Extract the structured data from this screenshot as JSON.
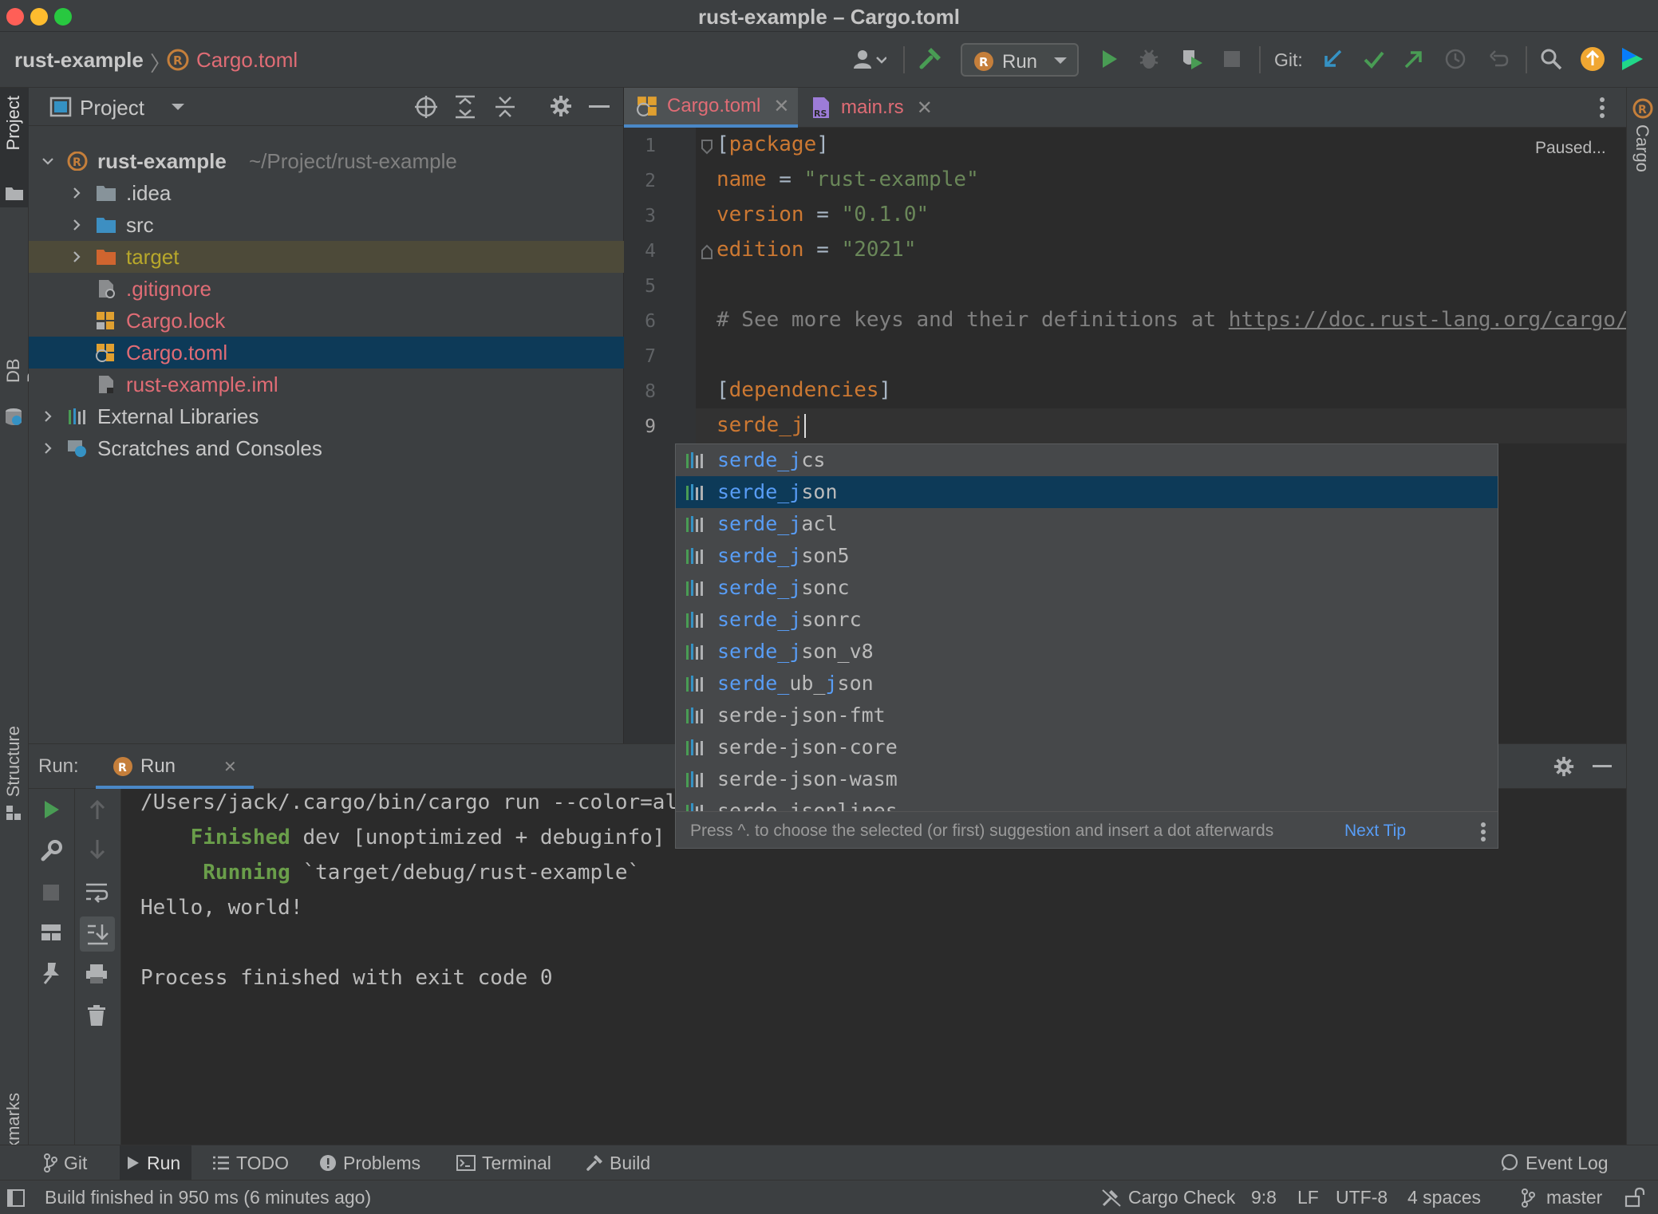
{
  "window": {
    "title": "rust-example – Cargo.toml"
  },
  "breadcrumb": {
    "project": "rust-example",
    "file": "Cargo.toml"
  },
  "toolbar": {
    "run_config": "Run",
    "git_label": "Git:"
  },
  "left_strip": {
    "project": "Project",
    "db_browser": "DB Browser",
    "structure": "Structure",
    "bookmarks": "Bookmarks"
  },
  "right_strip": {
    "cargo": "Cargo"
  },
  "project_panel": {
    "title": "Project",
    "tree": [
      {
        "name": "rust-example",
        "path": "~/Project/rust-example"
      },
      {
        "name": ".idea"
      },
      {
        "name": "src"
      },
      {
        "name": "target"
      },
      {
        "name": ".gitignore"
      },
      {
        "name": "Cargo.lock"
      },
      {
        "name": "Cargo.toml"
      },
      {
        "name": "rust-example.iml"
      },
      {
        "name": "External Libraries"
      },
      {
        "name": "Scratches and Consoles"
      }
    ]
  },
  "editor_tabs": [
    {
      "label": "Cargo.toml"
    },
    {
      "label": "main.rs"
    }
  ],
  "editor": {
    "status": "Paused...",
    "line_numbers": [
      "1",
      "2",
      "3",
      "4",
      "5",
      "6",
      "7",
      "8",
      "9"
    ],
    "lines": {
      "l1_open": "[",
      "l1_key": "package",
      "l1_close": "]",
      "l2_key": "name",
      "l2_eq": " = ",
      "l2_val": "\"rust-example\"",
      "l3_key": "version",
      "l3_eq": " = ",
      "l3_val": "\"0.1.0\"",
      "l4_key": "edition",
      "l4_eq": " = ",
      "l4_val": "\"2021\"",
      "l6_comment": "# See more keys and their definitions at ",
      "l6_link": "https://doc.rust-lang.org/cargo/",
      "l8_open": "[",
      "l8_key": "dependencies",
      "l8_close": "]",
      "l9_text": "serde_j"
    }
  },
  "completion": {
    "items": [
      {
        "match": "serde_j",
        "rest": "cs"
      },
      {
        "match": "serde_j",
        "rest": "son"
      },
      {
        "match": "serde_j",
        "rest": "acl"
      },
      {
        "match": "serde_j",
        "rest": "son5"
      },
      {
        "match": "serde_j",
        "rest": "sonc"
      },
      {
        "match": "serde_j",
        "rest": "sonrc"
      },
      {
        "match": "serde_j",
        "rest": "son_v8"
      },
      {
        "match": "serde_",
        "mid": "ub_",
        "match2": "j",
        "rest": "son"
      },
      {
        "rest": "serde-json-fmt"
      },
      {
        "rest": "serde-json-core"
      },
      {
        "rest": "serde-json-wasm"
      },
      {
        "rest": "serde-jsonlines"
      }
    ],
    "tip": "Press ^. to choose the selected (or first) suggestion and insert a dot afterwards",
    "next_tip": "Next Tip"
  },
  "run_panel": {
    "label": "Run:",
    "tab": "Run",
    "output": {
      "l1": "/Users/jack/.cargo/bin/cargo run --color=al",
      "l2_kw": "    Finished",
      "l2_rest": " dev [unoptimized + debuginfo]",
      "l3_kw": "     Running",
      "l3_rest": " `target/debug/rust-example`",
      "l4": "Hello, world!",
      "l6": "Process finished with exit code 0"
    }
  },
  "bottom_tabs": [
    {
      "label": "Git"
    },
    {
      "label": "Run"
    },
    {
      "label": "TODO"
    },
    {
      "label": "Problems"
    },
    {
      "label": "Terminal"
    },
    {
      "label": "Build"
    },
    {
      "label": "Event Log"
    }
  ],
  "status_bar": {
    "message": "Build finished in 950 ms (6 minutes ago)",
    "cargo_check": "Cargo Check",
    "position": "9:8",
    "line_sep": "LF",
    "encoding": "UTF-8",
    "indent": "4 spaces",
    "branch": "master"
  },
  "colors": {
    "accent": "#0d3a58",
    "keyword": "#cc7832",
    "string": "#6a8759",
    "match": "#589df6",
    "error_file": "#e06c75"
  }
}
